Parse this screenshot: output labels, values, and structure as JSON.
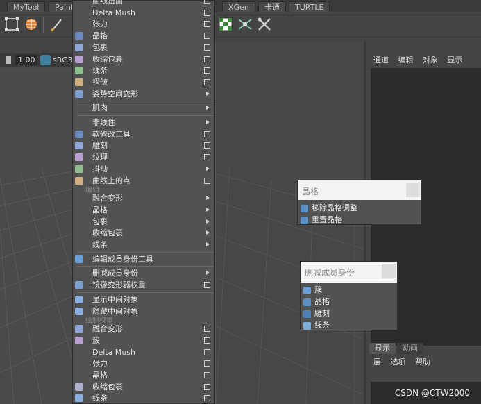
{
  "shelf_tabs": [
    "MyTool",
    "Paint",
    "XGen",
    "卡通",
    "TURTLE"
  ],
  "viewport_bar": {
    "value": "1.00",
    "color_space": "sRGB"
  },
  "channel_box": {
    "menu": [
      "通道",
      "编辑",
      "对象",
      "显示"
    ]
  },
  "layer_editor": {
    "tabs": [
      "显示",
      "动画"
    ],
    "menu": [
      "层",
      "选项",
      "帮助"
    ]
  },
  "deform_menu": {
    "items_top": [
      {
        "label": "曲线扭曲",
        "kind": "box"
      },
      {
        "label": "Delta Mush",
        "kind": "box"
      },
      {
        "label": "张力",
        "kind": "box"
      },
      {
        "label": "晶格",
        "kind": "box"
      },
      {
        "label": "包裹",
        "kind": "box"
      },
      {
        "label": "收缩包裹",
        "kind": "box"
      },
      {
        "label": "线条",
        "kind": "box"
      },
      {
        "label": "褶皱",
        "kind": "box"
      },
      {
        "label": "姿势空间变形",
        "kind": "arrow"
      }
    ],
    "muscle": "肌肉",
    "items_mid": [
      {
        "label": "非线性",
        "kind": "arrow"
      },
      {
        "label": "软修改工具",
        "kind": "box"
      },
      {
        "label": "雕刻",
        "kind": "box"
      },
      {
        "label": "纹理",
        "kind": "box"
      },
      {
        "label": "抖动",
        "kind": "arrow"
      },
      {
        "label": "曲线上的点",
        "kind": "box"
      }
    ],
    "section_edit": "编辑",
    "items_edit": [
      {
        "label": "融合变形",
        "kind": "arrow"
      },
      {
        "label": "晶格",
        "kind": "arrow"
      },
      {
        "label": "包裹",
        "kind": "arrow"
      },
      {
        "label": "收缩包裹",
        "kind": "arrow"
      },
      {
        "label": "线条",
        "kind": "arrow"
      }
    ],
    "membership_tool": "编辑成员身份工具",
    "items_membership": [
      {
        "label": "删减成员身份",
        "kind": "arrow"
      },
      {
        "label": "镜像变形器权重",
        "kind": "box"
      }
    ],
    "show_intermediate": "显示中间对象",
    "hide_intermediate": "隐藏中间对象",
    "section_paint": "绘制权重",
    "items_paint": [
      {
        "label": "融合变形",
        "kind": "box"
      },
      {
        "label": "簇",
        "kind": "box"
      },
      {
        "label": "Delta Mush",
        "kind": "box"
      },
      {
        "label": "张力",
        "kind": "box"
      },
      {
        "label": "晶格",
        "kind": "box"
      },
      {
        "label": "收缩包裹",
        "kind": "box"
      },
      {
        "label": "线条",
        "kind": "box"
      }
    ]
  },
  "lattice_panel": {
    "title": "晶格",
    "items": [
      "移除晶格调整",
      "重置晶格"
    ]
  },
  "prune_panel": {
    "title": "删减成员身份",
    "items": [
      "簇",
      "晶格",
      "雕刻",
      "线条"
    ]
  },
  "watermark": "CSDN @CTW2000",
  "colors": {
    "menu_bg": "#525252",
    "panel_header": "#f4f4f4",
    "accent_icon": "#5a8fc8"
  }
}
